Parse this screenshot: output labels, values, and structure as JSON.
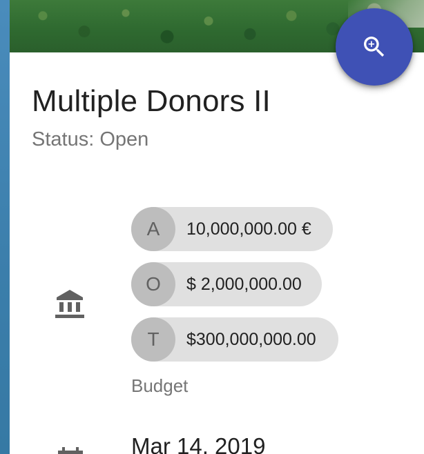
{
  "project": {
    "title": "Multiple Donors II",
    "status": "Status: Open"
  },
  "actions": {
    "zoom_icon": "zoom-in-icon"
  },
  "budget": {
    "icon": "bank-icon",
    "label": "Budget",
    "donors": [
      {
        "initial": "A",
        "amount": "10,000,000.00 €"
      },
      {
        "initial": "O",
        "amount": "$ 2,000,000.00"
      },
      {
        "initial": "T",
        "amount": "$300,000,000.00"
      }
    ]
  },
  "timeline": {
    "icon": "calendar-icon",
    "date": "Mar 14, 2019"
  },
  "colors": {
    "fab": "#3f51b5",
    "chip_bg": "#e0e0e0",
    "chip_avatar": "#bdbdbd",
    "sidebar_edge": "#3d82b0"
  }
}
